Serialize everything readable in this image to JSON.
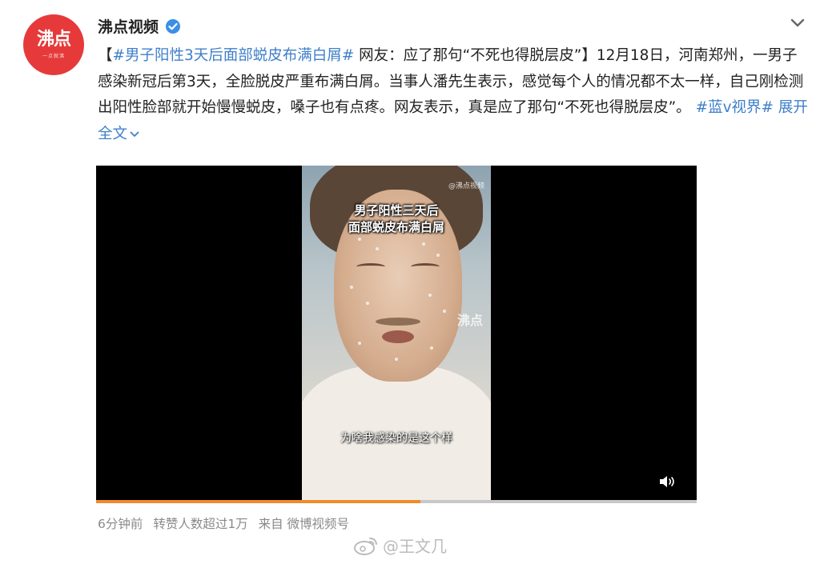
{
  "author": {
    "name": "沸点视频",
    "avatar_text": "沸点",
    "avatar_subtext": "一点就沸",
    "verified_icon": "verified-badge-icon"
  },
  "menu": {
    "icon": "chevron-down-icon"
  },
  "post": {
    "open_bracket": "【",
    "hashtag_main": "#男子阳性3天后面部蜕皮布满白屑#",
    "headline_tail": " 网友：应了那句“不死也得脱层皮”】",
    "body": "12月18日，河南郑州，一男子感染新冠后第3天，全脸脱皮严重布满白屑。当事人潘先生表示，感觉每个人的情况都不太一样，自己刚检测出阳性脸部就开始慢慢蜕皮，嗓子也有点疼。网友表示，真是应了那句“不死也得脱层皮”。",
    "hashtag_topic": "#蓝v视界#",
    "expand_label": "展开全文"
  },
  "video": {
    "overlay_title_line1": "男子阳性三天后",
    "overlay_title_line2": "面部蜕皮布满白屑",
    "overlay_caption": "为啥我感染的是这个样",
    "watermark_top": "@沸点视频",
    "watermark_side": "沸点",
    "progress": 0.54,
    "progress_color": "#f08a2c"
  },
  "meta": {
    "time": "6分钟前",
    "reposts": "转赞人数超过1万",
    "source": "来自 微博视频号"
  },
  "watermark": {
    "text": "@王文几",
    "icon": "weibo-logo-icon"
  },
  "colors": {
    "link": "#3f7fc9",
    "brand_red": "#e63a3a",
    "meta_gray": "#8a8a8a"
  }
}
